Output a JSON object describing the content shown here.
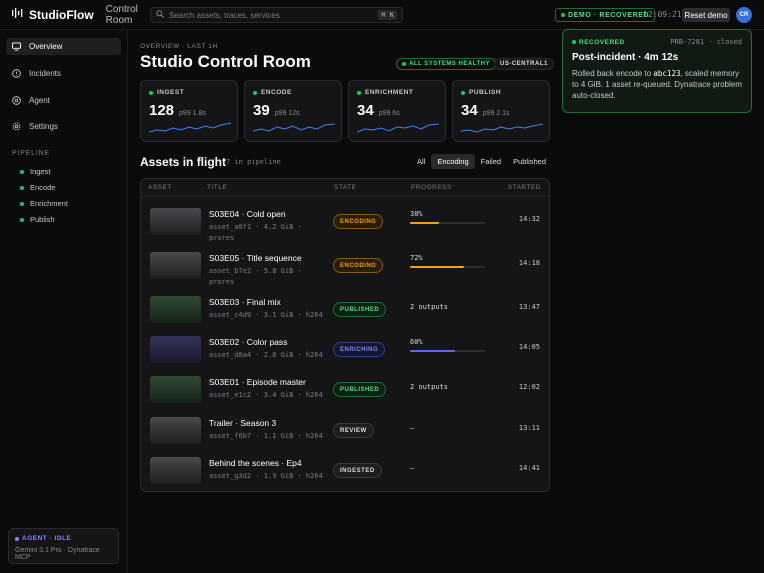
{
  "app": {
    "name": "StudioFlow",
    "section": "Control Room"
  },
  "search": {
    "placeholder": "Search assets, traces, services",
    "shortcut": "⌘ K"
  },
  "header": {
    "demo_badge": "DEMO · RECOVERED",
    "clock": "12:09:21",
    "reset_label": "Reset demo",
    "avatar_initials": "CR"
  },
  "sidebar": {
    "items": [
      {
        "label": "Overview",
        "icon": "monitor-icon",
        "active": true
      },
      {
        "label": "Incidents",
        "icon": "alert-circle-icon"
      },
      {
        "label": "Agent",
        "icon": "agent-icon"
      },
      {
        "label": "Settings",
        "icon": "gear-icon"
      }
    ],
    "pipeline_label": "PIPELINE",
    "pipeline": [
      "Ingest",
      "Encode",
      "Enrichment",
      "Publish"
    ],
    "agent": {
      "status": "AGENT · IDLE",
      "model": "Gemini 3.1 Pro · Dynatrace MCP"
    }
  },
  "main": {
    "breadcrumb": "OVERVIEW · LAST 1H",
    "title": "Studio Control Room",
    "health": "ALL SYSTEMS HEALTHY",
    "region": "US-CENTRAL1",
    "kpis": [
      {
        "label": "INGEST",
        "value": "128",
        "sub": "p99 1.8s"
      },
      {
        "label": "ENCODE",
        "value": "39",
        "sub": "p99 12s"
      },
      {
        "label": "ENRICHMENT",
        "value": "34",
        "sub": "p99 6s"
      },
      {
        "label": "PUBLISH",
        "value": "34",
        "sub": "p99 2.1s"
      }
    ],
    "assets_title": "Assets in flight",
    "assets_sub": "7 in pipeline",
    "filters": [
      {
        "label": "All"
      },
      {
        "label": "Encoding",
        "active": true
      },
      {
        "label": "Failed"
      },
      {
        "label": "Published"
      }
    ],
    "columns": [
      "ASSET",
      "TITLE",
      "STATE",
      "PROGRESS",
      "STARTED"
    ],
    "rows": [
      {
        "title": "S03E04 · Cold open",
        "meta": "asset_a8f1 · 4.2 GiB · prores",
        "state": "ENCODING",
        "progress": "38%",
        "progress_value": 0.38,
        "started": "14:32"
      },
      {
        "title": "S03E05 · Title sequence",
        "meta": "asset_b7e2 · 5.8 GiB · prores",
        "state": "ENCODING",
        "progress": "72%",
        "progress_value": 0.72,
        "started": "14:18"
      },
      {
        "title": "S03E03 · Final mix",
        "meta": "asset_c4d9 · 3.1 GiB · h264",
        "state": "PUBLISHED",
        "progress": "2 outputs",
        "started": "13:47"
      },
      {
        "title": "S03E02 · Color pass",
        "meta": "asset_d8a4 · 2.8 GiB · h264",
        "state": "ENRICHING",
        "progress": "60%",
        "progress_value": 0.6,
        "started": "14:05"
      },
      {
        "title": "S03E01 · Episode master",
        "meta": "asset_e1c2 · 3.4 GiB · h264",
        "state": "PUBLISHED",
        "progress": "2 outputs",
        "started": "12:02"
      },
      {
        "title": "Trailer · Season 3",
        "meta": "asset_f6b7 · 1.1 GiB · h264",
        "state": "REVIEW",
        "progress": "—",
        "started": "13:11"
      },
      {
        "title": "Behind the scenes · Ep4",
        "meta": "asset_g3d2 · 1.9 GiB · h264",
        "state": "INGESTED",
        "progress": "—",
        "started": "14:41"
      }
    ]
  },
  "toast": {
    "status": "RECOVERED",
    "id": "PRB-7281 · closed",
    "title": "Post-incident · 4m 12s",
    "body_pre": "Rolled back encode to ",
    "body_code": "abc123",
    "body_post": ", scaled memory to 4 GiB. 1 asset re-queued. Dynatrace problem auto-closed."
  },
  "colors": {
    "accent_green": "#22c55e",
    "encoding": "#f59e0b",
    "enriching": "#6366f1",
    "sparkline": "#3b82f6"
  }
}
